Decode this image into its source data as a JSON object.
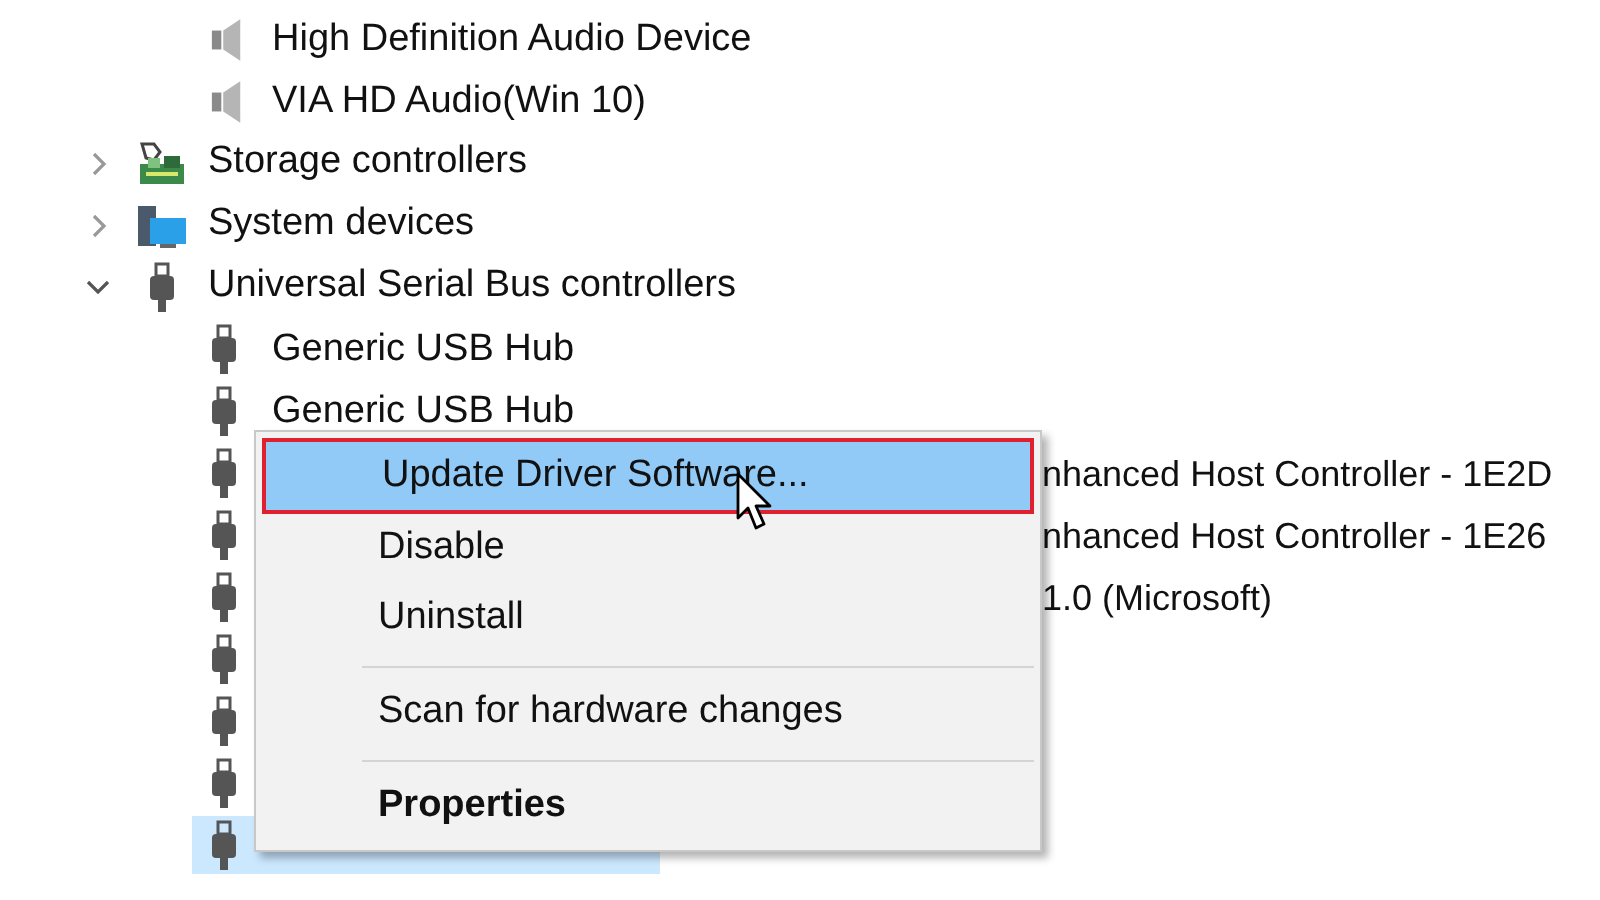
{
  "tree": [
    {
      "kind": "group",
      "children": [
        {
          "kind": "speaker",
          "label": "High Definition Audio Device",
          "selected": false
        },
        {
          "kind": "speaker",
          "label": "VIA HD Audio(Win 10)",
          "selected": false
        }
      ]
    },
    {
      "kind": "storage",
      "label": "Storage controllers",
      "expanded": false,
      "selected": false
    },
    {
      "kind": "system",
      "label": "System devices",
      "expanded": false,
      "selected": false
    },
    {
      "kind": "usb",
      "label": "Universal Serial Bus controllers",
      "expanded": true,
      "selected": false,
      "children": [
        {
          "kind": "usb",
          "label": "Generic USB Hub",
          "selected": false
        },
        {
          "kind": "usb",
          "label": "Generic USB Hub",
          "selected": false
        },
        {
          "kind": "usb",
          "label": "nhanced Host Controller - 1E2D",
          "covered": true,
          "selected": false
        },
        {
          "kind": "usb",
          "label": "nhanced Host Controller - 1E26",
          "covered": true,
          "selected": false
        },
        {
          "kind": "usb",
          "label": "1.0 (Microsoft)",
          "covered": true,
          "selected": false
        },
        {
          "kind": "usb",
          "selected": false
        },
        {
          "kind": "usb",
          "selected": false
        },
        {
          "kind": "usb",
          "selected": false
        },
        {
          "kind": "usb",
          "selected": true
        }
      ]
    }
  ],
  "context_menu": [
    {
      "kind": "item",
      "label": "Update Driver Software...",
      "selected": true
    },
    {
      "kind": "item",
      "label": "Disable",
      "selected": false
    },
    {
      "kind": "item",
      "label": "Uninstall",
      "selected": false
    },
    {
      "kind": "separator"
    },
    {
      "kind": "item",
      "label": "Scan for hardware changes",
      "selected": false
    },
    {
      "kind": "separator"
    },
    {
      "kind": "item",
      "label": "Properties",
      "selected": false,
      "default": true
    }
  ]
}
